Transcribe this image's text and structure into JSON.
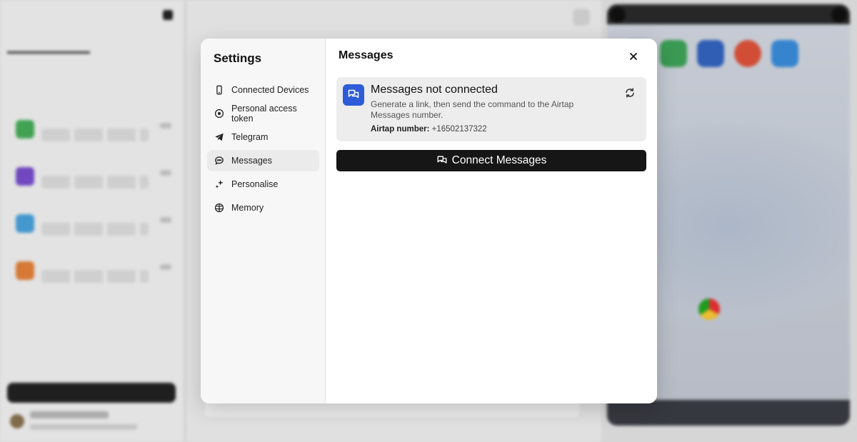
{
  "settings": {
    "title": "Settings",
    "nav": [
      {
        "label": "Connected Devices",
        "icon": "phone-icon"
      },
      {
        "label": "Personal access token",
        "icon": "token-icon"
      },
      {
        "label": "Telegram",
        "icon": "telegram-icon"
      },
      {
        "label": "Messages",
        "icon": "message-icon",
        "active": true
      },
      {
        "label": "Personalise",
        "icon": "sparkle-icon"
      },
      {
        "label": "Memory",
        "icon": "brain-icon"
      }
    ]
  },
  "messages_panel": {
    "title": "Messages",
    "status_title": "Messages not connected",
    "status_desc": "Generate a link, then send the command to the Airtap Messages number.",
    "number_label": "Airtap number:",
    "number_value": "+16502137322",
    "connect_label": "Connect Messages"
  },
  "colors": {
    "accent_blue": "#2e5cd8",
    "primary_button": "#161616"
  }
}
